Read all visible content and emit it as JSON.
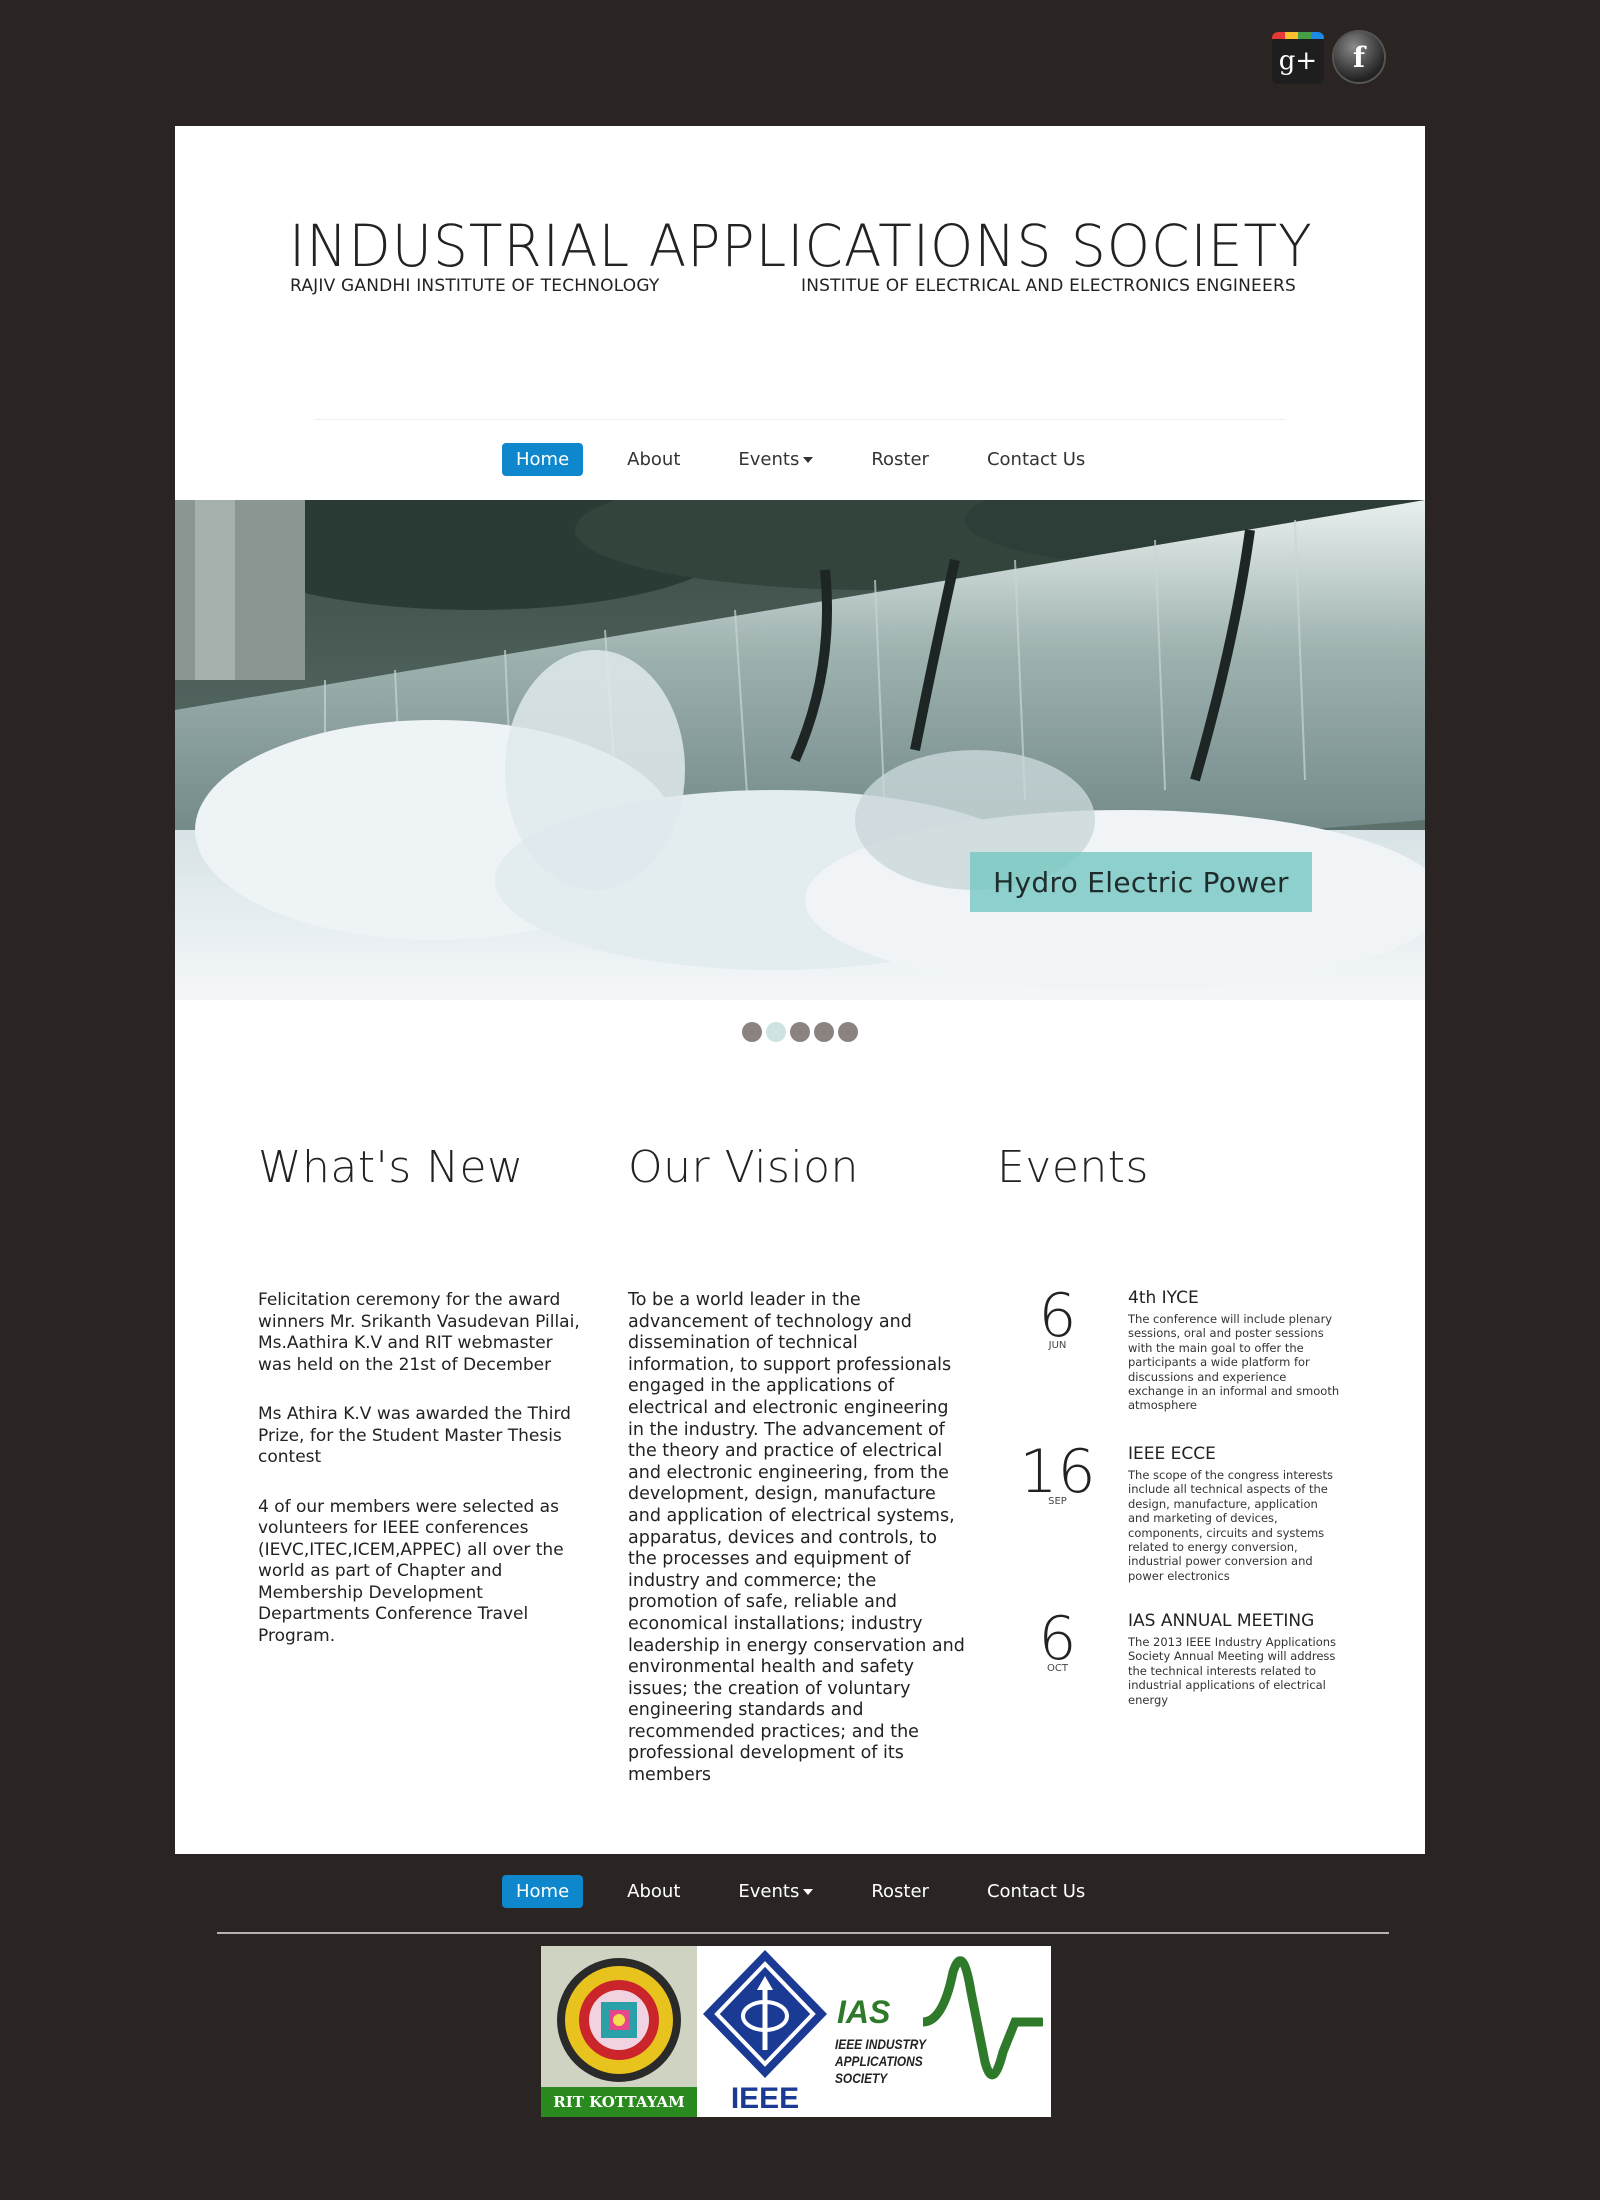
{
  "social": {
    "gplus_label": "g+",
    "fb_label": "f",
    "gplus_colors": [
      "#e53935",
      "#fbc02d",
      "#43a047",
      "#1e88e5"
    ]
  },
  "header": {
    "title": "INDUSTRIAL APPLICATIONS SOCIETY",
    "subtitle_left": "RAJIV GANDHI INSTITUTE OF TECHNOLOGY",
    "subtitle_right": "INSTITUE OF ELECTRICAL AND ELECTRONICS ENGINEERS"
  },
  "nav": {
    "items": [
      {
        "label": "Home",
        "active": true
      },
      {
        "label": "About"
      },
      {
        "label": "Events",
        "dropdown": true
      },
      {
        "label": "Roster"
      },
      {
        "label": "Contact Us"
      }
    ]
  },
  "slider": {
    "caption": "Hydro Electric Power",
    "slide_count": 5,
    "active_index": 1
  },
  "whats_new": {
    "heading": "What's New",
    "items": [
      "Felicitation ceremony for the award winners Mr. Srikanth Vasudevan Pillai, Ms.Aathira K.V and RIT webmaster was held on the 21st of December",
      "Ms Athira K.V was awarded the Third Prize, for the Student Master Thesis contest",
      "4 of our members were selected as volunteers for IEEE conferences (IEVC,ITEC,ICEM,APPEC) all over the world as part of Chapter and Membership Development Departments Conference Travel Program."
    ]
  },
  "vision": {
    "heading": "Our Vision",
    "text": "To be a world leader in the advancement of technology and dissemination of technical information, to support professionals engaged in the applications of electrical and electronic engineering in the industry. The advancement of the theory and practice of electrical and electronic engineering, from the development, design, manufacture and application of electrical systems, apparatus, devices and controls, to the processes and equipment of industry and commerce; the promotion of safe, reliable and economical installations; industry leadership in energy conservation and environmental health and safety issues; the creation of voluntary engineering standards and recommended practices; and the professional development of its members"
  },
  "events": {
    "heading": "Events",
    "items": [
      {
        "day": "6",
        "month": "JUN",
        "title": "4th IYCE",
        "desc": "The conference will include plenary sessions, oral and poster sessions with the main goal to offer the participants a wide platform for discussions and experience exchange in an informal and smooth atmosphere"
      },
      {
        "day": "16",
        "month": "SEP",
        "title": "IEEE ECCE",
        "desc": "The scope of the congress interests include all technical aspects of the design, manufacture, application and marketing of devices, components, circuits and systems related to energy conversion, industrial power conversion and power electronics"
      },
      {
        "day": "6",
        "month": "OCT",
        "title": "IAS ANNUAL MEETING",
        "desc": "The 2013 IEEE Industry Applications Society Annual Meeting will address the technical interests related to industrial applications of electrical energy"
      }
    ]
  },
  "footer_logos": {
    "rit_label": "RIT KOTTAYAM",
    "ieee_label": "IEEE",
    "ias_label": "IAS",
    "ias_sub": "IEEE INDUSTRY APPLICATIONS SOCIETY"
  },
  "colors": {
    "page_bg": "#2a2522",
    "nav_active": "#0f87cc",
    "caption_bg": "#78c8c3",
    "ieee_blue": "#1a3a94",
    "ias_green": "#2f7a2a"
  }
}
